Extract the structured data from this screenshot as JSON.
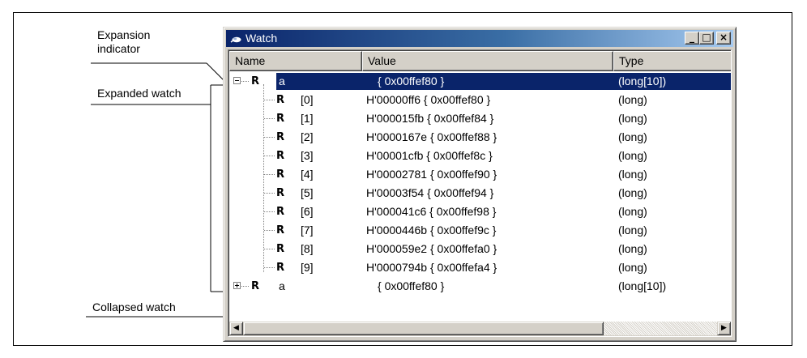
{
  "annotations": {
    "expansion_indicator": [
      "Expansion",
      "indicator"
    ],
    "expanded_watch": "Expanded watch",
    "collapsed_watch": "Collapsed watch"
  },
  "window": {
    "title": "Watch",
    "buttons": {
      "minimize": "_",
      "maximize": "□",
      "close": "×"
    }
  },
  "columns": {
    "name": "Name",
    "value": "Value",
    "type": "Type"
  },
  "rows": [
    {
      "name": "a",
      "value": "{ 0x00ffef80 }",
      "type": "(long[10])",
      "level": 0,
      "expander": "minus",
      "selected": true
    },
    {
      "name": "[0]",
      "value": "H'00000ff6 { 0x00ffef80 }",
      "type": "(long)",
      "level": 1
    },
    {
      "name": "[1]",
      "value": "H'000015fb { 0x00ffef84 }",
      "type": "(long)",
      "level": 1
    },
    {
      "name": "[2]",
      "value": "H'0000167e { 0x00ffef88 }",
      "type": "(long)",
      "level": 1
    },
    {
      "name": "[3]",
      "value": "H'00001cfb { 0x00ffef8c }",
      "type": "(long)",
      "level": 1
    },
    {
      "name": "[4]",
      "value": "H'00002781 { 0x00ffef90 }",
      "type": "(long)",
      "level": 1
    },
    {
      "name": "[5]",
      "value": "H'00003f54 { 0x00ffef94 }",
      "type": "(long)",
      "level": 1
    },
    {
      "name": "[6]",
      "value": "H'000041c6 { 0x00ffef98 }",
      "type": "(long)",
      "level": 1
    },
    {
      "name": "[7]",
      "value": "H'0000446b { 0x00ffef9c }",
      "type": "(long)",
      "level": 1
    },
    {
      "name": "[8]",
      "value": "H'000059e2 { 0x00ffefa0 }",
      "type": "(long)",
      "level": 1
    },
    {
      "name": "[9]",
      "value": "H'0000794b { 0x00ffefa4 }",
      "type": "(long)",
      "level": 1
    },
    {
      "name": "a",
      "value": "{ 0x00ffef80 }",
      "type": "(long[10])",
      "level": 0,
      "expander": "plus"
    }
  ],
  "icons": {
    "register": "register-icon",
    "app": "watch-app-icon"
  },
  "colors": {
    "selection": "#0a246a",
    "titlebar_start": "#0a246a",
    "titlebar_end": "#a6caf0",
    "chrome": "#d4d0c8"
  }
}
